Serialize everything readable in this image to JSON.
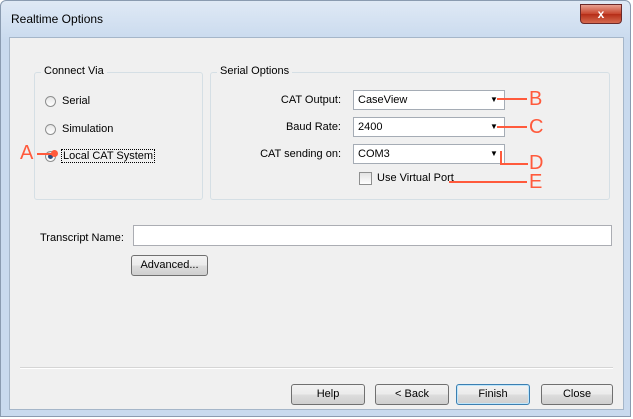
{
  "window": {
    "title": "Realtime Options",
    "close_glyph": "x"
  },
  "connect_via": {
    "group_label": "Connect Via",
    "options": [
      {
        "label": "Serial",
        "checked": false
      },
      {
        "label": "Simulation",
        "checked": false
      },
      {
        "label": "Local CAT System",
        "checked": true
      }
    ]
  },
  "serial_options": {
    "group_label": "Serial Options",
    "cat_output": {
      "label": "CAT Output:",
      "value": "CaseView"
    },
    "baud_rate": {
      "label": "Baud Rate:",
      "value": "2400"
    },
    "cat_sending_on": {
      "label": "CAT sending on:",
      "value": "COM3"
    },
    "virtual_port": {
      "label": "Use Virtual Port",
      "checked": false
    }
  },
  "transcript": {
    "label": "Transcript Name:",
    "value": ""
  },
  "advanced_label": "Advanced...",
  "footer": {
    "help": "Help",
    "back": "< Back",
    "finish": "Finish",
    "close": "Close"
  },
  "callouts": {
    "a": "A",
    "b": "B",
    "c": "C",
    "d": "D",
    "e": "E",
    "color": "#ff5a3c"
  },
  "icons": {
    "dropdown": "chevron-down-icon",
    "close": "close-icon"
  }
}
